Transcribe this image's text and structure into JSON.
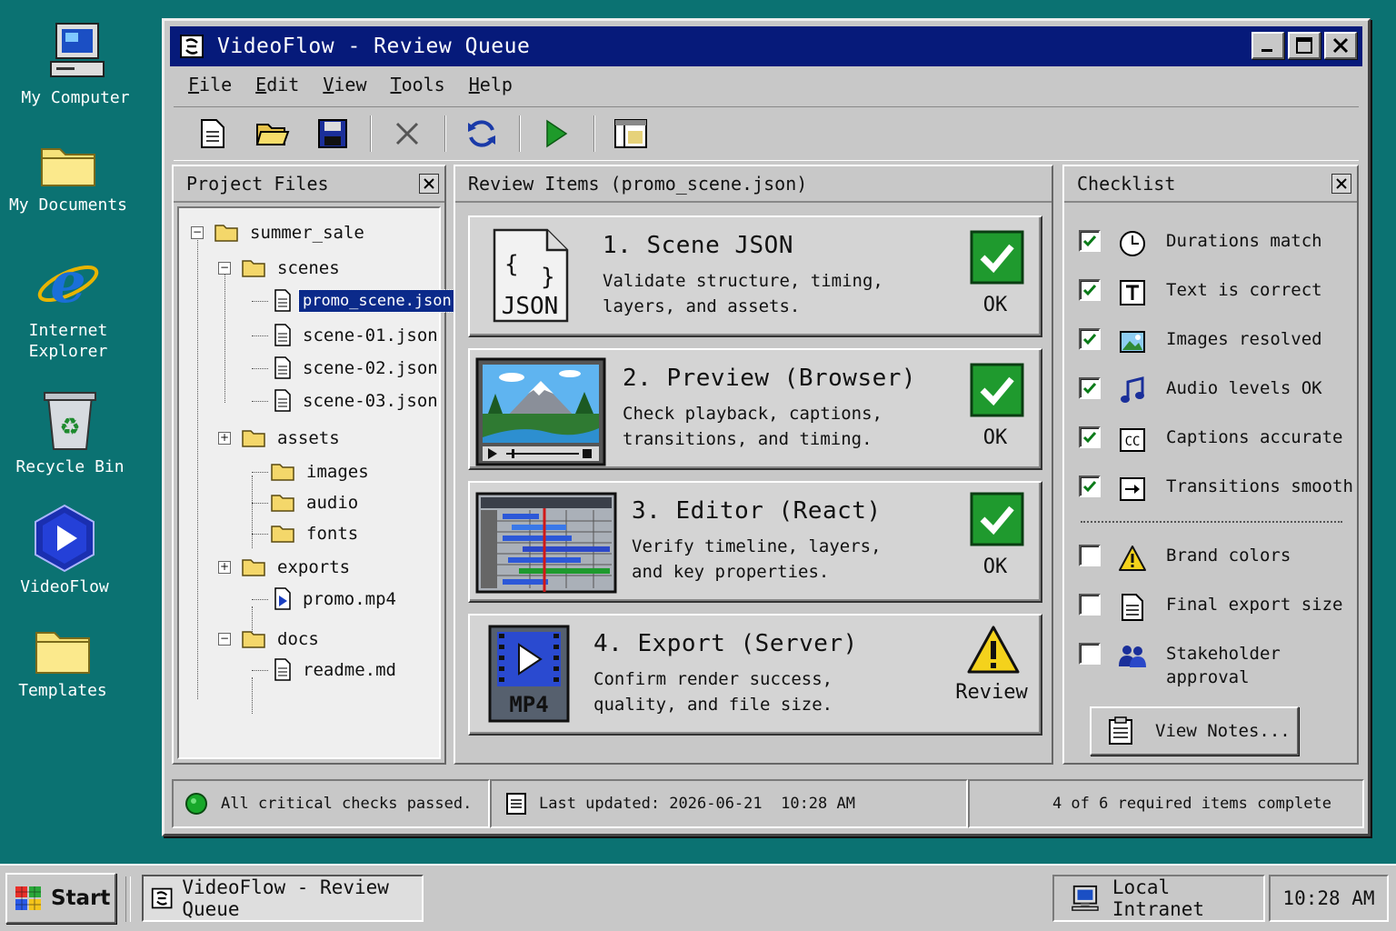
{
  "desktop": {
    "icons": [
      {
        "label": "My Computer",
        "icon": "computer-icon"
      },
      {
        "label": "My Documents",
        "icon": "folder-icon"
      },
      {
        "label": "Internet\nExplorer",
        "icon": "internet-explorer-icon"
      },
      {
        "label": "Recycle Bin",
        "icon": "recycle-bin-icon"
      },
      {
        "label": "VideoFlow",
        "icon": "videoflow-icon"
      },
      {
        "label": "Templates",
        "icon": "folder-icon"
      }
    ]
  },
  "window": {
    "title": "VideoFlow - Review Queue",
    "controls": [
      "minimize-icon",
      "maximize-icon",
      "close-icon"
    ],
    "menu": [
      "File",
      "Edit",
      "View",
      "Tools",
      "Help"
    ],
    "toolbar": [
      "new-file-icon",
      "open-folder-icon",
      "save-icon",
      "delete-icon",
      "refresh-icon",
      "play-icon",
      "layout-icon"
    ]
  },
  "project_files": {
    "title": "Project Files",
    "tree": {
      "root": "summer_sale",
      "scenes": "scenes",
      "selected_file": "promo_scene.json",
      "scene1": "scene-01.json",
      "scene2": "scene-02.json",
      "scene3": "scene-03.json",
      "assets": "assets",
      "images": "images",
      "audio": "audio",
      "fonts": "fonts",
      "exports": "exports",
      "mp4": "promo.mp4",
      "docs": "docs",
      "readme": "readme.md"
    }
  },
  "review": {
    "title": "Review Items (promo_scene.json)",
    "items": [
      {
        "title": "1. Scene JSON",
        "desc": "Validate structure, timing,\nlayers, and assets.",
        "status": "OK",
        "icon": "json-file-icon",
        "status_icon": "check-icon"
      },
      {
        "title": "2. Preview (Browser)",
        "desc": "Check playback, captions,\ntransitions, and timing.",
        "status": "OK",
        "icon": "video-preview-icon",
        "status_icon": "check-icon"
      },
      {
        "title": "3. Editor (React)",
        "desc": "Verify timeline, layers,\nand key properties.",
        "status": "OK",
        "icon": "timeline-editor-icon",
        "status_icon": "check-icon"
      },
      {
        "title": "4. Export (Server)",
        "desc": "Confirm render success,\nquality, and file size.",
        "status": "Review",
        "icon": "mp4-file-icon",
        "status_icon": "warning-icon"
      }
    ],
    "json_label": "JSON",
    "mp4_label": "MP4"
  },
  "checklist": {
    "title": "Checklist",
    "items": [
      {
        "label": "Durations match",
        "checked": true,
        "icon": "clock-icon"
      },
      {
        "label": "Text is correct",
        "checked": true,
        "icon": "text-icon"
      },
      {
        "label": "Images resolved",
        "checked": true,
        "icon": "image-icon"
      },
      {
        "label": "Audio levels OK",
        "checked": true,
        "icon": "music-note-icon"
      },
      {
        "label": "Captions accurate",
        "checked": true,
        "icon": "captions-icon"
      },
      {
        "label": "Transitions smooth",
        "checked": true,
        "icon": "transition-icon"
      },
      {
        "label": "Brand colors",
        "checked": false,
        "icon": "warning-icon"
      },
      {
        "label": "Final export size",
        "checked": false,
        "icon": "document-icon"
      },
      {
        "label": "Stakeholder\napproval",
        "checked": false,
        "icon": "users-icon"
      }
    ],
    "captions_label": "CC",
    "notes_button": "View Notes..."
  },
  "statusbar": {
    "message": "All critical checks passed.",
    "updated": "Last updated: 2026-06-21  10:28 AM",
    "progress": "4 of 6 required items complete"
  },
  "taskbar": {
    "start": "Start",
    "task": "VideoFlow - Review Queue",
    "network": "Local Intranet",
    "clock": "10:28 AM"
  },
  "colors": {
    "desktop": "#0b7272",
    "titlebar": "#061a7a",
    "ok_green": "#1f9a2e",
    "warning_yellow": "#f4d21c"
  }
}
